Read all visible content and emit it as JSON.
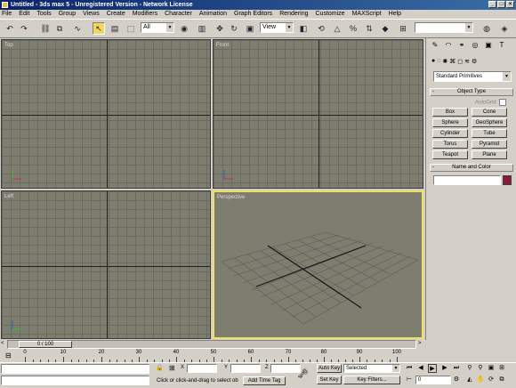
{
  "window": {
    "title": "Untitled - 3ds max 5 - Unregistered Version - Network License",
    "controls": [
      "_",
      "□",
      "×"
    ]
  },
  "menu": [
    "File",
    "Edit",
    "Tools",
    "Group",
    "Views",
    "Create",
    "Modifiers",
    "Character",
    "Animation",
    "Graph Editors",
    "Rendering",
    "Customize",
    "MAXScript",
    "Help"
  ],
  "toolbar": {
    "selection_filter": "All",
    "ref_coord": "View"
  },
  "viewports": {
    "top": "Top",
    "front": "Front",
    "left": "Left",
    "perspective": "Perspective"
  },
  "command_panel": {
    "category_dropdown": "Standard Primitives",
    "object_type_title": "Object Type",
    "autogrid_label": "AutoGrid",
    "object_buttons": [
      "Box",
      "Cone",
      "Sphere",
      "GeoSphere",
      "Cylinder",
      "Tube",
      "Torus",
      "Pyramid",
      "Teapot",
      "Plane"
    ],
    "name_color_title": "Name and Color",
    "rollout_toggle": "-",
    "color_swatch": "#8a1a3a"
  },
  "time_slider": {
    "frame_label": "0 / 100",
    "prev_arrow": "<",
    "next_arrow": ">"
  },
  "track_bar": {
    "ticks": [
      "0",
      "10",
      "20",
      "30",
      "40",
      "50",
      "60",
      "70",
      "80",
      "90",
      "100"
    ]
  },
  "status": {
    "prompt_text": "Click or click-and-drag to select ob",
    "add_time_tag": "Add Time Tag",
    "x_label": "X",
    "y_label": "Y",
    "z_label": "Z",
    "auto_key": "Auto Key",
    "set_key": "Set Key",
    "key_mode": "Selected",
    "key_filters": "Key Filters...",
    "current_frame": "0"
  }
}
